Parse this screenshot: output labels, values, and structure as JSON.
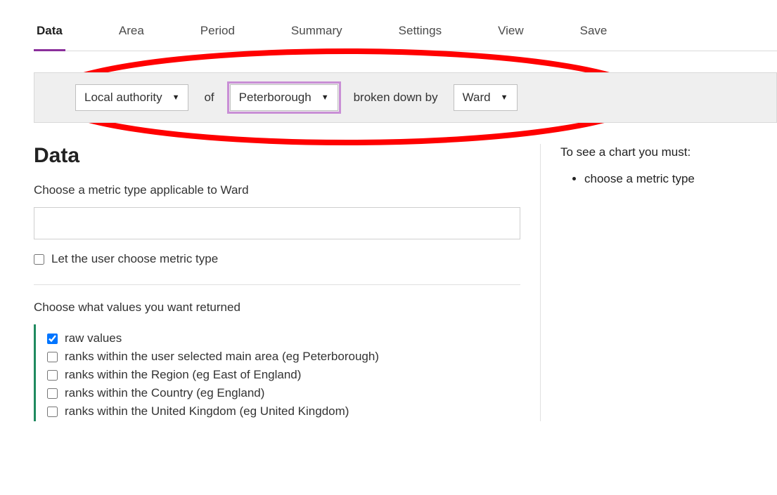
{
  "tabs": {
    "items": [
      {
        "label": "Data",
        "active": true
      },
      {
        "label": "Area",
        "active": false
      },
      {
        "label": "Period",
        "active": false
      },
      {
        "label": "Summary",
        "active": false
      },
      {
        "label": "Settings",
        "active": false
      },
      {
        "label": "View",
        "active": false
      },
      {
        "label": "Save",
        "active": false
      }
    ]
  },
  "filter": {
    "geography_type": "Local authority",
    "of_word": "of",
    "area_name": "Peterborough",
    "breakdown_word": "broken down by",
    "breakdown_type": "Ward"
  },
  "main": {
    "title": "Data",
    "metric_prompt": "Choose a metric type applicable to Ward",
    "metric_value": "",
    "user_choose_label": "Let the user choose metric type",
    "user_choose_checked": false,
    "values_prompt": "Choose what values you want returned",
    "value_options": [
      {
        "label": "raw values",
        "checked": true
      },
      {
        "label": "ranks within the user selected main area (eg Peterborough)",
        "checked": false
      },
      {
        "label": "ranks within the Region (eg East of England)",
        "checked": false
      },
      {
        "label": "ranks within the Country (eg England)",
        "checked": false
      },
      {
        "label": "ranks within the United Kingdom (eg United Kingdom)",
        "checked": false
      }
    ]
  },
  "sidebar": {
    "hint_title": "To see a chart you must:",
    "hint_items": [
      "choose a metric type"
    ]
  }
}
